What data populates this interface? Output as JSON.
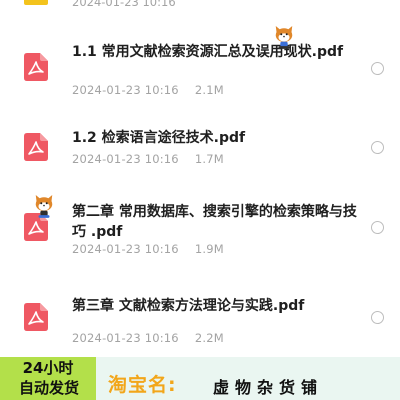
{
  "colors": {
    "pdf_icon": "#ef5863",
    "meta_text": "#a3a3a3",
    "promo_green": "#b3e04a",
    "promo_orange": "#f2a61a",
    "promo_bg": "#eaf6f1"
  },
  "top_partial": {
    "date": "2024-01-23 10:16"
  },
  "files": [
    {
      "title": "1.1 常用文献检索资源汇总及误用现状.pdf",
      "date": "2024-01-23 10:16",
      "size": "2.1M",
      "icon": "pdf-icon"
    },
    {
      "title": "1.2 检索语言途径技术.pdf",
      "date": "2024-01-23 10:16",
      "size": "1.7M",
      "icon": "pdf-icon"
    },
    {
      "title": "第二章 常用数据库、搜索引擎的检索策略与技巧 .pdf",
      "date": "2024-01-23 10:16",
      "size": "1.9M",
      "icon": "pdf-icon"
    },
    {
      "title": "第三章 文献检索方法理论与实践.pdf",
      "date": "2024-01-23 10:16",
      "size": "2.2M",
      "icon": "pdf-icon"
    }
  ],
  "promo": {
    "line1": "24小时",
    "line2": "自动发货",
    "shop_label": "淘宝名:",
    "shop_name": "虚物杂货铺"
  }
}
